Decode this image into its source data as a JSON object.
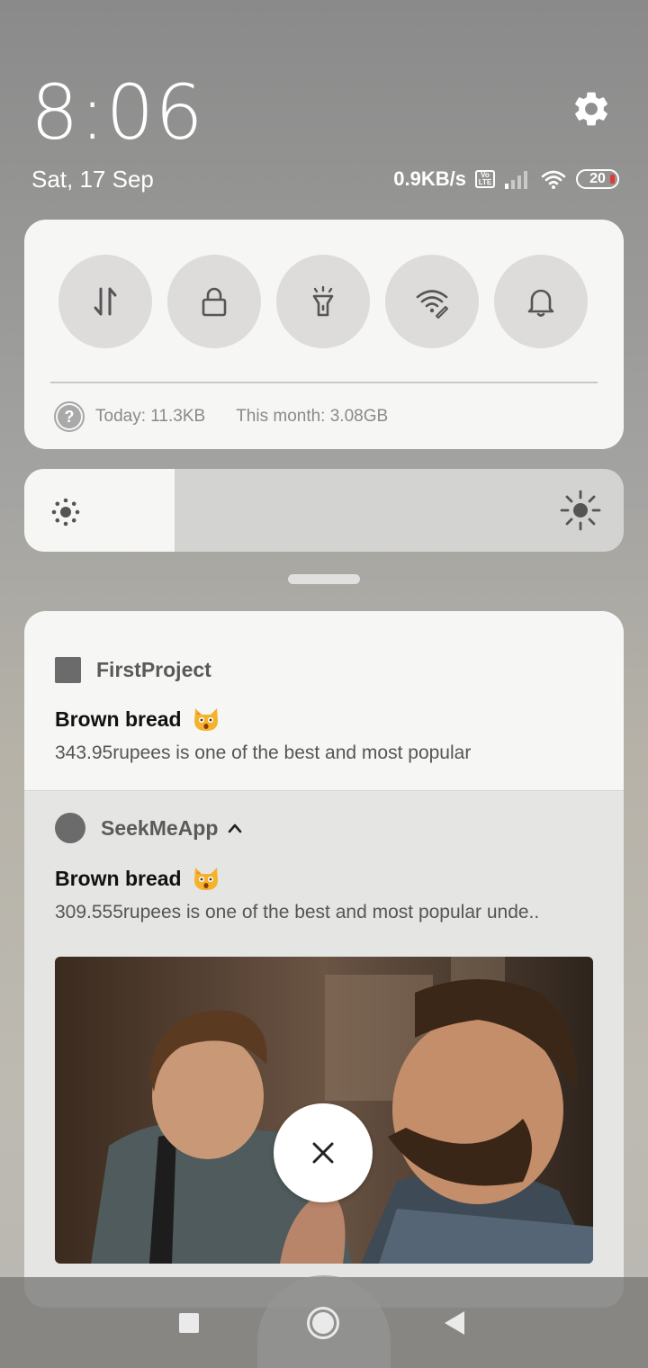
{
  "header": {
    "time": "8:06",
    "date": "Sat, 17 Sep",
    "net_speed": "0.9KB/s",
    "volte_top": "Vo",
    "volte_bottom": "LTE",
    "battery": "20"
  },
  "quick_settings": {
    "tiles": [
      {
        "icon": "data-transfer-icon"
      },
      {
        "icon": "lock-icon"
      },
      {
        "icon": "flashlight-icon"
      },
      {
        "icon": "wifi-hotspot-icon"
      },
      {
        "icon": "bell-icon"
      }
    ],
    "usage": {
      "help_glyph": "?",
      "today": "Today: 11.3KB",
      "month": "This month: 3.08GB"
    }
  },
  "brightness": {
    "level": 0.25
  },
  "notifications": [
    {
      "app": "FirstProject",
      "title": "Brown bread",
      "body": "343.95rupees is one of the best and most popular"
    },
    {
      "app": "SeekMeApp",
      "title": "Brown bread",
      "body": "309.555rupees is one of the best and most popular unde.."
    }
  ],
  "colors": {
    "card_bg": "#f6f6f5",
    "tile_bg": "#dddcda",
    "icon_color": "#555555",
    "battery_low": "#e53935"
  }
}
